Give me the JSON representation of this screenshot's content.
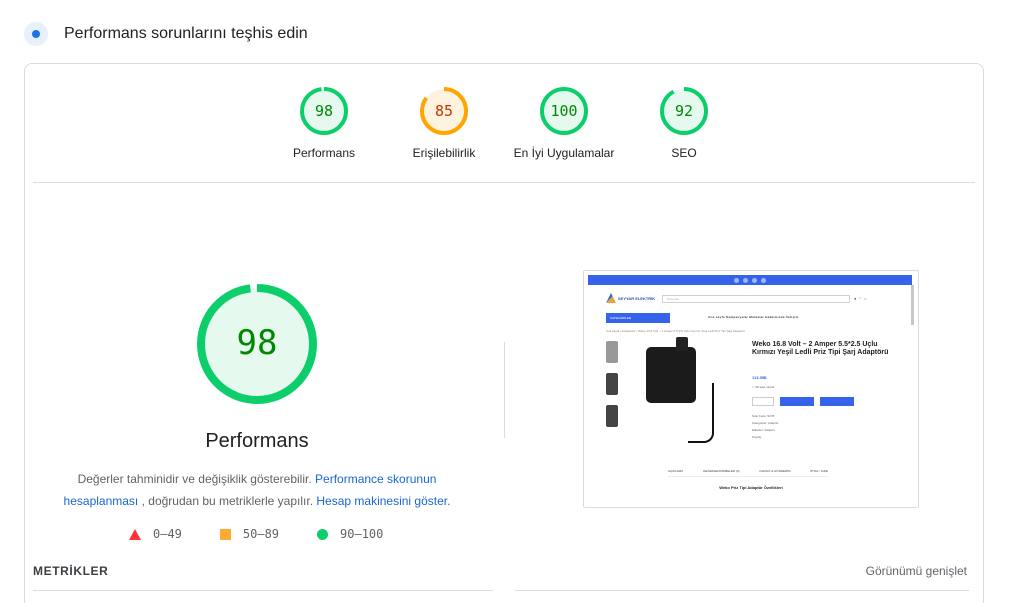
{
  "header": {
    "title": "Performans sorunlarını teşhis edin"
  },
  "gauges": [
    {
      "score": "98",
      "label": "Performans",
      "value": 0.98,
      "color": "#0cce6b",
      "fill": "#e6f9ef",
      "text_color": "#008800"
    },
    {
      "score": "85",
      "label": "Erişilebilirlik",
      "value": 0.85,
      "color": "#ffa400",
      "fill": "#fff3e0",
      "text_color": "#c33300"
    },
    {
      "score": "100",
      "label": "En İyi Uygulamalar",
      "value": 1.0,
      "color": "#0cce6b",
      "fill": "#e6f9ef",
      "text_color": "#008800"
    },
    {
      "score": "92",
      "label": "SEO",
      "value": 0.92,
      "color": "#0cce6b",
      "fill": "#e6f9ef",
      "text_color": "#008800"
    }
  ],
  "main": {
    "score": "98",
    "score_value": 0.98,
    "label": "Performans",
    "desc_text1": "Değerler tahminidir ve değişiklik gösterebilir.",
    "desc_link1": "Performance skorunun hesaplanması",
    "desc_text2": ", doğrudan bu metriklerle yapılır.",
    "desc_link2": "Hesap makinesini göster."
  },
  "legend": {
    "low": "0–49",
    "mid": "50–89",
    "high": "90–100"
  },
  "screenshot": {
    "brand": "SEYYAR ELEKTRİK",
    "search_placeholder": "Ürün ara",
    "category_label": "KATEGORİLER",
    "nav": "Ana sayfa   Kampanyalar   Markalar   Hakkımızda   İletişim",
    "breadcrumb": "Ana sayfa / Adaptörler / Weko 16.8 Volt – 2 Amper 5.5*2.5 Uçlu Kırmızı Yeşil Ledli Priz Tipi Şarj Adaptörü",
    "product_title": "Weko 16.8 Volt – 2 Amper 5.5*2.5 Uçlu Kırmızı Yeşil Ledli Priz Tipi Şarj Adaptörü",
    "price": "113.55₺",
    "stock": "✓ 99 adet stokta",
    "meta": "Stok Kodu: 5278\nKategoriler: Adaptör\nEtiketler: Adaptör\nPaylaş:",
    "tabs": [
      "AÇIKLAMA",
      "DEĞERLENDİRMELER (0)",
      "KARGO & GÖNDERİM",
      "İPTAL / İADE"
    ],
    "subheading": "Weko Priz Tipi Adaptör Özellikleri"
  },
  "metrics": {
    "title": "METRİKLER",
    "expand": "Görünümü genişlet"
  }
}
